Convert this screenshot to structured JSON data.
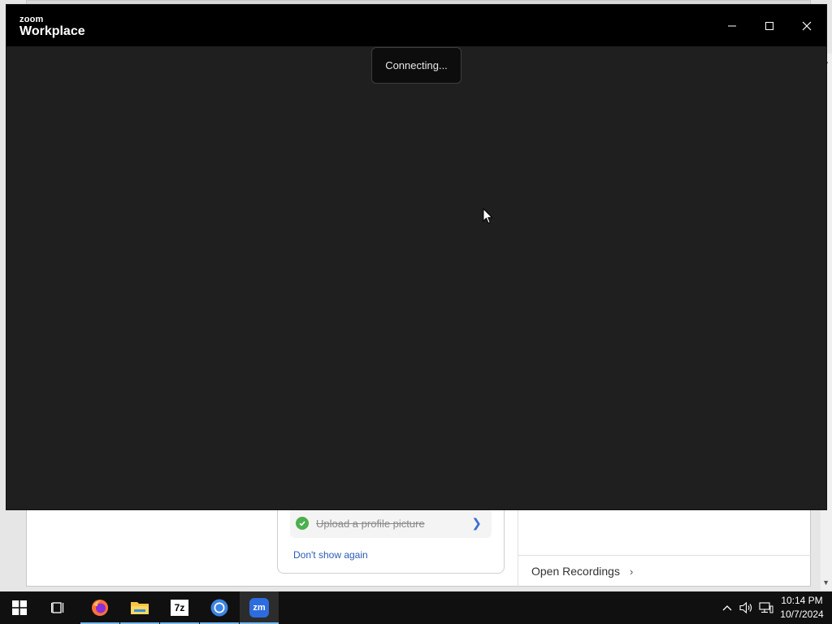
{
  "background_app": {
    "task_label": "Upload a profile picture",
    "dont_show_again": "Don't show again",
    "open_recordings": "Open Recordings"
  },
  "zoom_window": {
    "logo_small": "zoom",
    "logo_big": "Workplace",
    "status": "Connecting..."
  },
  "taskbar": {
    "apps": [
      "start",
      "task-view",
      "firefox",
      "file-explorer",
      "7zip",
      "chrome",
      "zoom"
    ],
    "sevenzip_label": "7z",
    "zoom_label": "zm",
    "time": "10:14 PM",
    "date": "10/7/2024"
  },
  "colors": {
    "zoom_blue": "#2d6cdf",
    "taskbar_bg": "#101010",
    "meeting_bg": "#1f1f1f"
  }
}
